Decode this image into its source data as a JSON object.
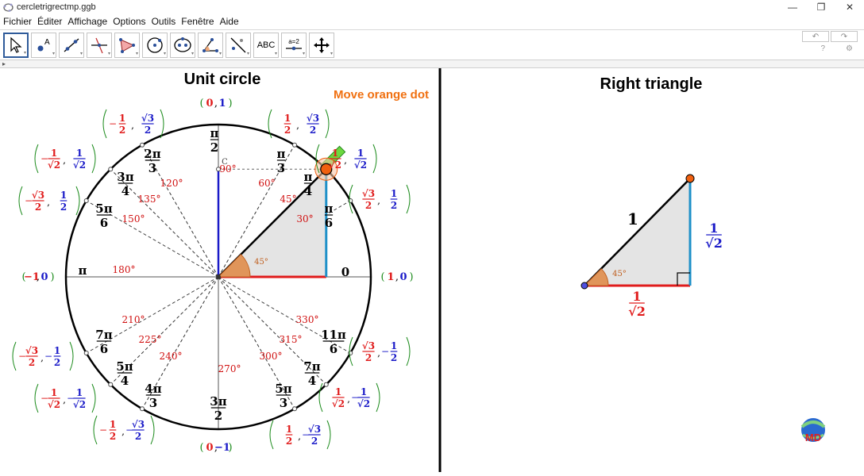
{
  "window": {
    "title": "cercletrigrectmp.ggb",
    "minimize": "—",
    "maximize": "❐",
    "close": "✕"
  },
  "menu": [
    "Fichier",
    "Éditer",
    "Affichage",
    "Options",
    "Outils",
    "Fenêtre",
    "Aide"
  ],
  "toolbar": {
    "tools": [
      "move-tool",
      "point-tool",
      "line-tool",
      "perpendicular-tool",
      "polygon-tool",
      "circle-tool",
      "ellipse-tool",
      "angle-tool",
      "reflect-tool",
      "text-tool",
      "slider-tool",
      "move-view-tool"
    ],
    "text_tool_label": "ABC",
    "slider_tool_label": "a=2",
    "undo": "↶",
    "redo": "↷",
    "help": "?",
    "settings": "⚙"
  },
  "left_panel": {
    "title": "Unit circle",
    "hint": "Move orange dot",
    "point_label": "C",
    "zero_label": "0",
    "angle_label": "45°",
    "radian_labels": [
      [
        "π",
        "2"
      ],
      [
        "π",
        "3"
      ],
      [
        "π",
        "4"
      ],
      [
        "π",
        "6"
      ],
      [
        "2π",
        "3"
      ],
      [
        "3π",
        "4"
      ],
      [
        "5π",
        "6"
      ],
      [
        "7π",
        "6"
      ],
      [
        "5π",
        "4"
      ],
      [
        "4π",
        "3"
      ],
      [
        "3π",
        "2"
      ],
      [
        "5π",
        "3"
      ],
      [
        "7π",
        "4"
      ],
      [
        "11π",
        "6"
      ]
    ],
    "pi_label": "π",
    "degree_labels": [
      "90°",
      "60°",
      "45°",
      "30°",
      "120°",
      "135°",
      "150°",
      "180°",
      "210°",
      "225°",
      "240°",
      "270°",
      "300°",
      "315°",
      "330°"
    ],
    "axis_coords": {
      "top": [
        "0",
        "1"
      ],
      "bottom": [
        "0",
        "−1"
      ],
      "left": [
        "−1",
        "0"
      ],
      "right": [
        "1",
        "0"
      ]
    },
    "coords": [
      {
        "x": "1",
        "y": "√3",
        "xd": "2",
        "yd": "2",
        "xs": "",
        "ys": ""
      },
      {
        "x": "1",
        "y": "1",
        "xd": "√2",
        "yd": "√2",
        "xs": "",
        "ys": ""
      },
      {
        "x": "√3",
        "y": "1",
        "xd": "2",
        "yd": "2",
        "xs": "",
        "ys": ""
      },
      {
        "x": "1",
        "y": "√3",
        "xd": "2",
        "yd": "2",
        "xs": "−",
        "ys": ""
      },
      {
        "x": "1",
        "y": "1",
        "xd": "√2",
        "yd": "√2",
        "xs": "−",
        "ys": ""
      },
      {
        "x": "√3",
        "y": "1",
        "xd": "2",
        "yd": "2",
        "xs": "−",
        "ys": ""
      },
      {
        "x": "√3",
        "y": "1",
        "xd": "2",
        "yd": "2",
        "xs": "−",
        "ys": "−"
      },
      {
        "x": "1",
        "y": "1",
        "xd": "√2",
        "yd": "√2",
        "xs": "−",
        "ys": "−"
      },
      {
        "x": "1",
        "y": "√3",
        "xd": "2",
        "yd": "2",
        "xs": "−",
        "ys": "−"
      },
      {
        "x": "1",
        "y": "√3",
        "xd": "2",
        "yd": "2",
        "xs": "",
        "ys": "−"
      },
      {
        "x": "1",
        "y": "1",
        "xd": "√2",
        "yd": "√2",
        "xs": "",
        "ys": "−"
      },
      {
        "x": "√3",
        "y": "1",
        "xd": "2",
        "yd": "2",
        "xs": "",
        "ys": "−"
      }
    ]
  },
  "right_panel": {
    "title": "Right triangle",
    "hypotenuse": "1",
    "angle_label": "45°",
    "opposite": [
      "1",
      "√2"
    ],
    "adjacent": [
      "1",
      "√2"
    ]
  },
  "logo": {
    "text": "MD"
  },
  "colors": {
    "red": "#e01b1b",
    "blue": "#1a1ac8",
    "green": "#1a8a1a",
    "orange": "#f06010",
    "cyan": "#1e90c8",
    "hint": "#f07010",
    "degree": "#d01010"
  }
}
